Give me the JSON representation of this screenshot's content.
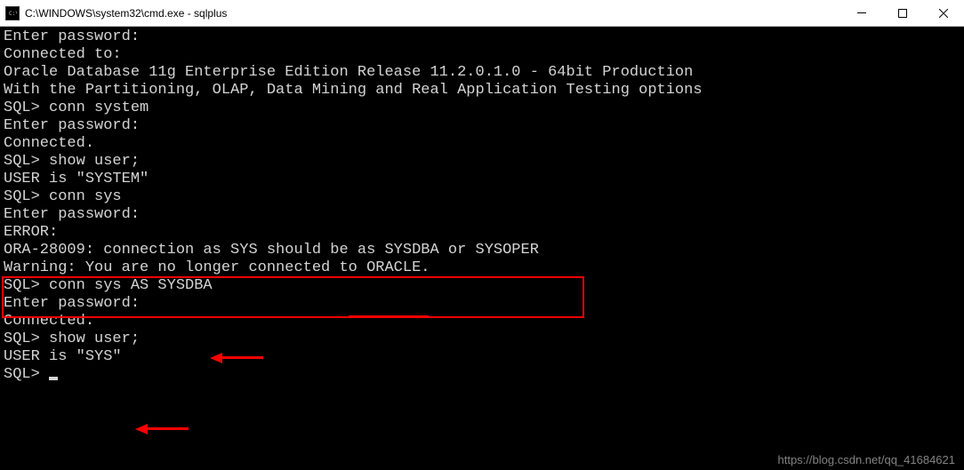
{
  "window": {
    "title": "C:\\WINDOWS\\system32\\cmd.exe - sqlplus"
  },
  "terminal": {
    "lines": [
      "Enter password:",
      "",
      "Connected to:",
      "Oracle Database 11g Enterprise Edition Release 11.2.0.1.0 - 64bit Production",
      "With the Partitioning, OLAP, Data Mining and Real Application Testing options",
      "",
      "SQL> conn system",
      "Enter password:",
      "Connected.",
      "SQL> show user;",
      "USER is \"SYSTEM\"",
      "SQL> conn sys",
      "Enter password:",
      "ERROR:",
      "ORA-28009: connection as SYS should be as SYSDBA or SYSOPER",
      "",
      "",
      "Warning: You are no longer connected to ORACLE.",
      "SQL> conn sys AS SYSDBA",
      "Enter password:",
      "Connected.",
      "SQL> show user;",
      "USER is \"SYS\"",
      "SQL> "
    ]
  },
  "watermark": "https://blog.csdn.net/qq_41684621"
}
